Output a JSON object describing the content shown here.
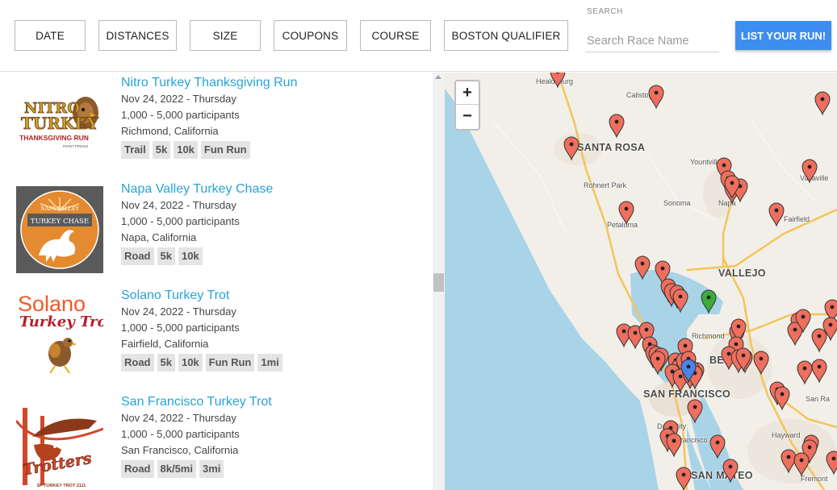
{
  "filters": {
    "date": "DATE",
    "distances": "DISTANCES",
    "size": "SIZE",
    "coupons": "COUPONS",
    "course": "COURSE",
    "boston": "BOSTON QUALIFIER"
  },
  "search": {
    "label": "SEARCH",
    "placeholder": "Search Race Name"
  },
  "list_button": "LIST YOUR RUN!",
  "races": [
    {
      "title": "Nitro Turkey Thanksgiving Run",
      "date": "Nov 24, 2022 - Thursday",
      "size": "1,000 - 5,000 participants",
      "location": "Richmond, California",
      "tags": [
        "Trail",
        "5k",
        "10k",
        "Fun Run"
      ],
      "logo": {
        "name": "nitro-turkey-logo",
        "text1": "NITRO",
        "text2": "TURKEY",
        "text3": "THANKSGIVING RUN",
        "text4": "POINT PINOLE"
      }
    },
    {
      "title": "Napa Valley Turkey Chase",
      "date": "Nov 24, 2022 - Thursday",
      "size": "1,000 - 5,000 participants",
      "location": "Napa, California",
      "tags": [
        "Road",
        "5k",
        "10k"
      ],
      "logo": {
        "name": "napa-valley-logo",
        "text1": "NAPA VALLEY",
        "text2": "TURKEY CHASE"
      }
    },
    {
      "title": "Solano Turkey Trot",
      "date": "Nov 24, 2022 - Thursday",
      "size": "1,000 - 5,000 participants",
      "location": "Fairfield, California",
      "tags": [
        "Road",
        "5k",
        "10k",
        "Fun Run",
        "1mi"
      ],
      "logo": {
        "name": "solano-logo",
        "text1": "Solano",
        "text2": "Turkey Trot"
      }
    },
    {
      "title": "San Francisco Turkey Trot",
      "date": "Nov 24, 2022 - Thursday",
      "size": "1,000 - 5,000 participants",
      "location": "San Francisco, California",
      "tags": [
        "Road",
        "8k/5mi",
        "3mi"
      ],
      "logo": {
        "name": "sf-turkey-trot-logo",
        "text1": "Trotters",
        "text2": "SF TURKEY TROT 2111"
      }
    }
  ],
  "map": {
    "zoom_in": "+",
    "zoom_out": "−",
    "labels": {
      "healdsburg": "Healdsburg",
      "calistoga": "Calistoga",
      "santa_rosa": "SANTA ROSA",
      "yountville": "Yountville",
      "rohnert_park": "Rohnert Park",
      "sonoma": "Sonoma",
      "napa": "Napa",
      "vacaville": "Vacaville",
      "petaluma": "Petaluma",
      "fairfield": "Fairfield",
      "vallejo": "VALLEJO",
      "richmond": "Richmond",
      "berkeley": "BE",
      "san_francisco": "SAN FRANCISCO",
      "daly_city": "Daly City",
      "south_sf": "San Francisco",
      "san_mateo": "SAN MATEO",
      "hayward": "Hayward",
      "fremont": "Fremont",
      "san_ramon": "San Ra"
    },
    "colors": {
      "pin": "#ee6f5e",
      "selected_pin": "#3aad3a",
      "current_pin": "#4a84e8",
      "water": "#a9d3e6",
      "land": "#f2efe8"
    }
  }
}
